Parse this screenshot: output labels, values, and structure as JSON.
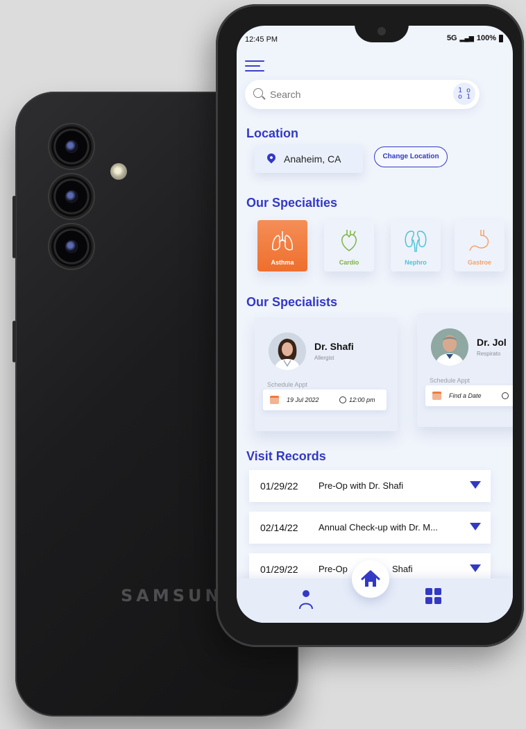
{
  "device_brand": "SAMSUNG",
  "status_bar": {
    "time": "12:45 PM",
    "network": "5G",
    "battery": "100%"
  },
  "search": {
    "placeholder": "Search"
  },
  "location": {
    "title": "Location",
    "city": "Anaheim, CA",
    "change_label": "Change Location"
  },
  "specialties": {
    "title": "Our Specialties",
    "items": [
      {
        "label": "Asthma",
        "icon": "lungs-icon",
        "color": "#ffffff",
        "active": true
      },
      {
        "label": "Cardio",
        "icon": "heart-icon",
        "color": "#7cb342"
      },
      {
        "label": "Nephro",
        "icon": "kidney-icon",
        "color": "#4fc3d7"
      },
      {
        "label": "Gastroe",
        "icon": "stomach-icon",
        "color": "#f4a36a"
      }
    ]
  },
  "specialists": {
    "title": "Our Specialists",
    "doctors": [
      {
        "name": "Dr. Shafi",
        "role": "Allergist",
        "appt_label": "Schedule Appt",
        "date": "19 Jul 2022",
        "time": "12:00 pm"
      },
      {
        "name": "Dr. Jol",
        "role": "Respirato",
        "appt_label": "Schedule Appt",
        "date": "Find a Date"
      }
    ]
  },
  "records": {
    "title": "Visit Records",
    "rows": [
      {
        "date": "01/29/22",
        "desc": "Pre-Op with Dr. Shafi"
      },
      {
        "date": "02/14/22",
        "desc": "Annual Check-up with Dr. M..."
      },
      {
        "date": "01/29/22",
        "desc_left": "Pre-Op",
        "desc_right": "Shafi"
      }
    ]
  },
  "colors": {
    "accent": "#3239c4",
    "specialty_active": "#ee6f2d",
    "background": "#f0f4fb"
  }
}
